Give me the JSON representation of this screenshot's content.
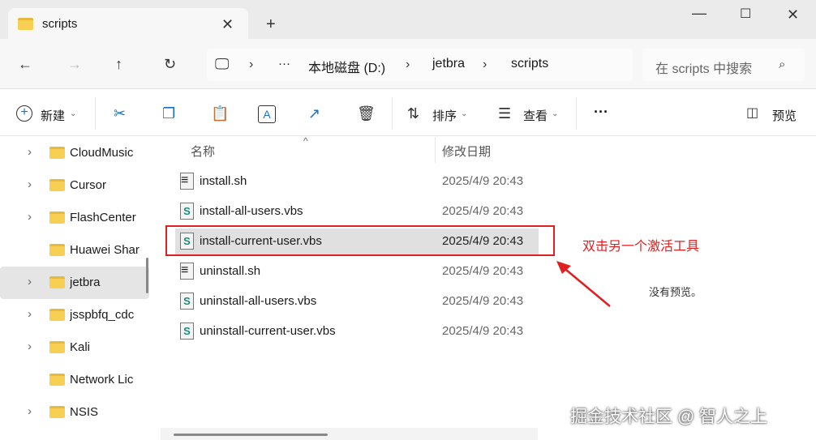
{
  "tab": {
    "title": "scripts"
  },
  "nav": {
    "more": "···",
    "breadcrumb": [
      "本地磁盘 (D:)",
      "jetbra",
      "scripts"
    ],
    "search_placeholder": "在 scripts 中搜索"
  },
  "toolbar": {
    "new": "新建",
    "sort": "排序",
    "view": "查看",
    "more": "···",
    "preview": "预览"
  },
  "sidebar": {
    "items": [
      {
        "label": "CloudMusic",
        "expandable": true
      },
      {
        "label": "Cursor",
        "expandable": true
      },
      {
        "label": "FlashCenter",
        "expandable": true
      },
      {
        "label": "Huawei Shar",
        "expandable": false
      },
      {
        "label": "jetbra",
        "expandable": true,
        "selected": true
      },
      {
        "label": "jsspbfq_cdc",
        "expandable": true
      },
      {
        "label": "Kali",
        "expandable": true
      },
      {
        "label": "Network Lic",
        "expandable": false
      },
      {
        "label": "NSIS",
        "expandable": true
      }
    ]
  },
  "list": {
    "columns": [
      "名称",
      "修改日期"
    ],
    "files": [
      {
        "name": "install.sh",
        "date": "2025/4/9 20:43",
        "type": "sh"
      },
      {
        "name": "install-all-users.vbs",
        "date": "2025/4/9 20:43",
        "type": "vbs"
      },
      {
        "name": "install-current-user.vbs",
        "date": "2025/4/9 20:43",
        "type": "vbs",
        "selected": true
      },
      {
        "name": "uninstall.sh",
        "date": "2025/4/9 20:43",
        "type": "sh"
      },
      {
        "name": "uninstall-all-users.vbs",
        "date": "2025/4/9 20:43",
        "type": "vbs"
      },
      {
        "name": "uninstall-current-user.vbs",
        "date": "2025/4/9 20:43",
        "type": "vbs"
      }
    ]
  },
  "preview": {
    "empty": "没有预览。"
  },
  "annotation": {
    "text": "双击另一个激活工具",
    "color": "#e02020"
  },
  "watermark": "掘金技术社区 @ 智人之上"
}
